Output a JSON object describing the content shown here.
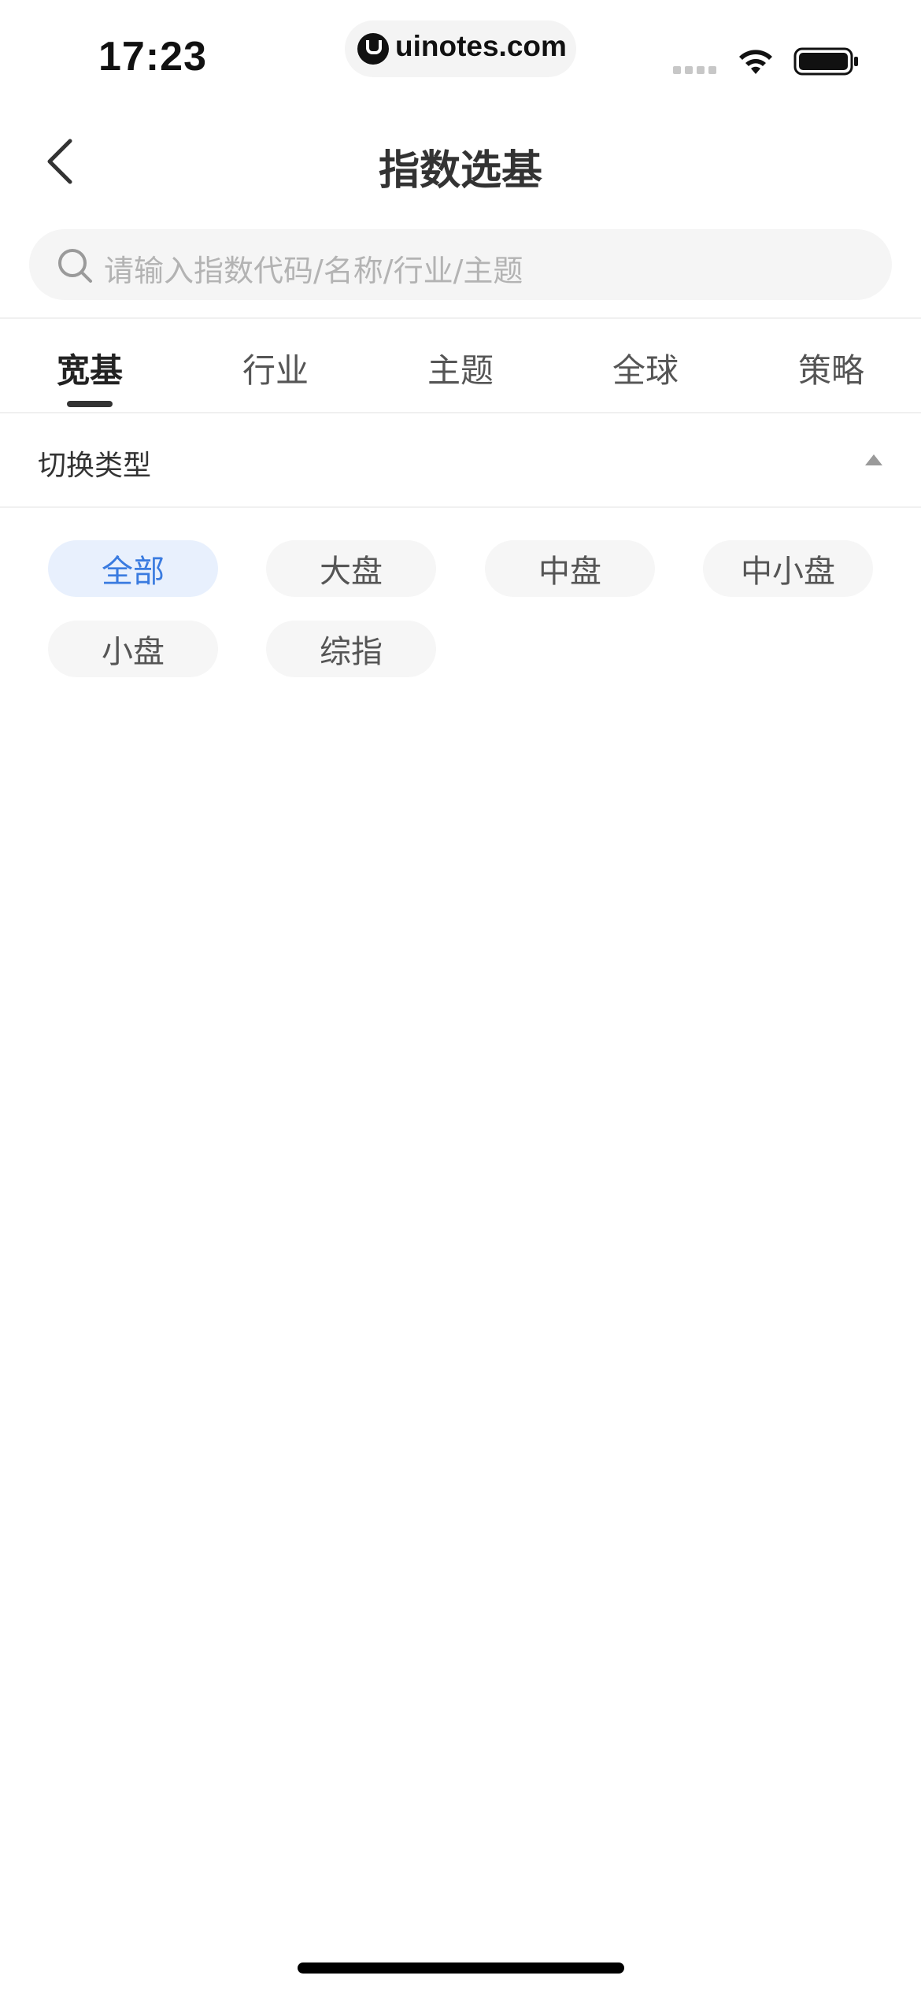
{
  "status_bar": {
    "time": "17:23",
    "watermark": "uinotes.com"
  },
  "nav": {
    "title": "指数选基"
  },
  "search": {
    "placeholder": "请输入指数代码/名称/行业/主题"
  },
  "tabs": [
    {
      "label": "宽基",
      "active": true
    },
    {
      "label": "行业",
      "active": false
    },
    {
      "label": "主题",
      "active": false
    },
    {
      "label": "全球",
      "active": false
    },
    {
      "label": "策略",
      "active": false
    }
  ],
  "filter": {
    "label": "切换类型",
    "expanded": true
  },
  "chips": [
    {
      "label": "全部",
      "selected": true
    },
    {
      "label": "大盘",
      "selected": false
    },
    {
      "label": "中盘",
      "selected": false
    },
    {
      "label": "中小盘",
      "selected": false
    },
    {
      "label": "小盘",
      "selected": false
    },
    {
      "label": "综指",
      "selected": false
    }
  ],
  "colors": {
    "accent": "#3a7be0",
    "selected_chip_bg": "#e8f0fd",
    "chip_bg": "#f6f6f6"
  }
}
